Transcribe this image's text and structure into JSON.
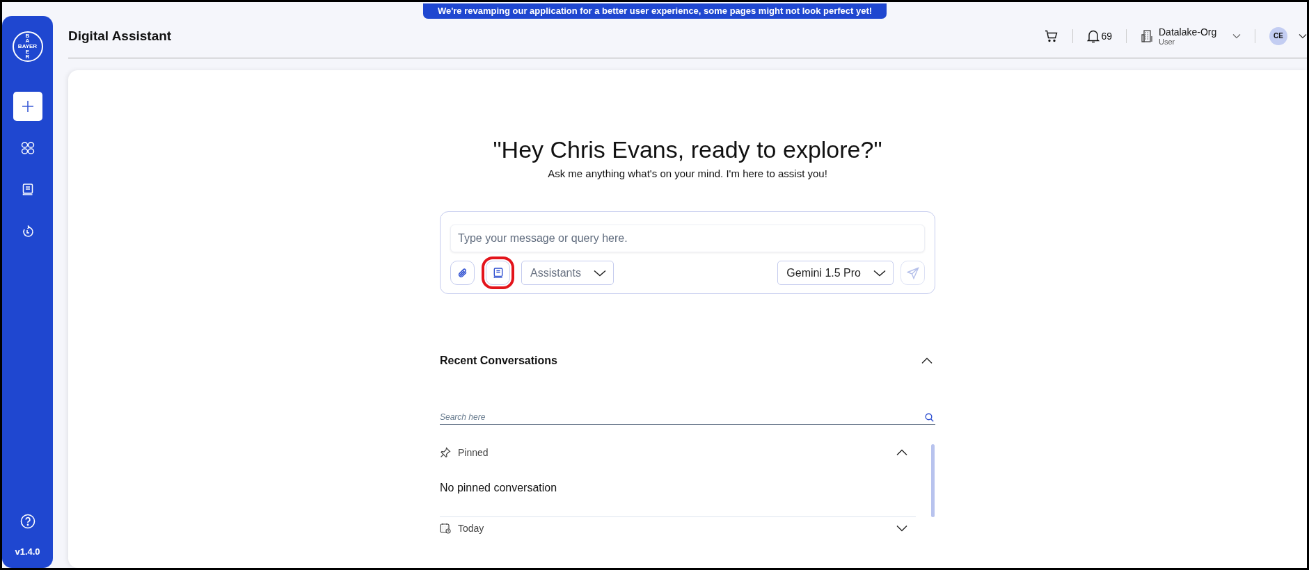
{
  "banner": {
    "text": "We're revamping our application for a better user experience, some pages might not look perfect yet!"
  },
  "sidebar": {
    "logo": {
      "horizontal": "BAYER",
      "vertical_top": "BA",
      "vertical_bottom": "ER"
    },
    "items": [
      {
        "kind": "new",
        "selected": true
      },
      {
        "kind": "apps",
        "selected": false
      },
      {
        "kind": "library",
        "selected": false
      },
      {
        "kind": "history",
        "selected": false
      }
    ],
    "version": "v1.4.0"
  },
  "header": {
    "title": "Digital Assistant",
    "notifications": "69",
    "org": {
      "name": "Datalake-Org",
      "role": "User"
    },
    "avatar": "CE"
  },
  "hero": {
    "heading": "\"Hey Chris Evans, ready to explore?\"",
    "subtitle": "Ask me anything what's on your mind. I'm here to assist you!"
  },
  "composer": {
    "placeholder": "Type your message or query here.",
    "tools": [
      {
        "kind": "attach",
        "highlighted": false
      },
      {
        "kind": "library",
        "highlighted": true
      }
    ],
    "assistant_select": {
      "placeholder": "Assistants"
    },
    "model_select": {
      "value": "Gemini 1.5 Pro"
    },
    "send": {
      "disabled": true
    }
  },
  "recent": {
    "title": "Recent Conversations",
    "expanded": true,
    "search": {
      "placeholder": "Search here"
    },
    "groups": [
      {
        "kind": "pinned",
        "label": "Pinned",
        "expanded": true,
        "empty_text": "No pinned conversation"
      },
      {
        "kind": "today",
        "label": "Today",
        "expanded": false
      }
    ]
  }
}
